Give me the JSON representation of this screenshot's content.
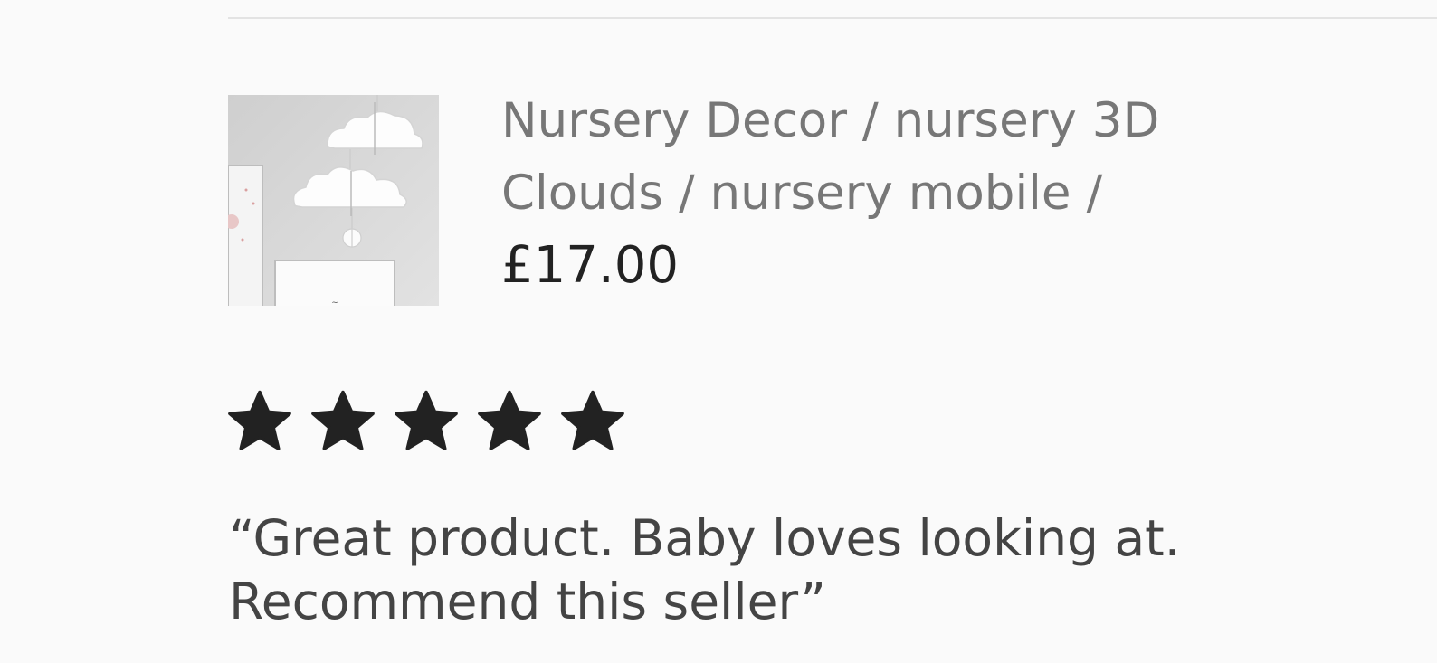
{
  "listing": {
    "thumbnail_alt": "nursery 3D clouds mobile",
    "title_lines": [
      "Nursery Decor / nursery 3D",
      "Clouds / nursery mobile /"
    ],
    "price": "£17.00"
  },
  "rating": {
    "stars": 5,
    "max": 5,
    "icon": "star-icon",
    "color": "#222222"
  },
  "review": {
    "text_lines": [
      "“Great product. Baby loves looking at.",
      "Recommend this seller”"
    ]
  }
}
